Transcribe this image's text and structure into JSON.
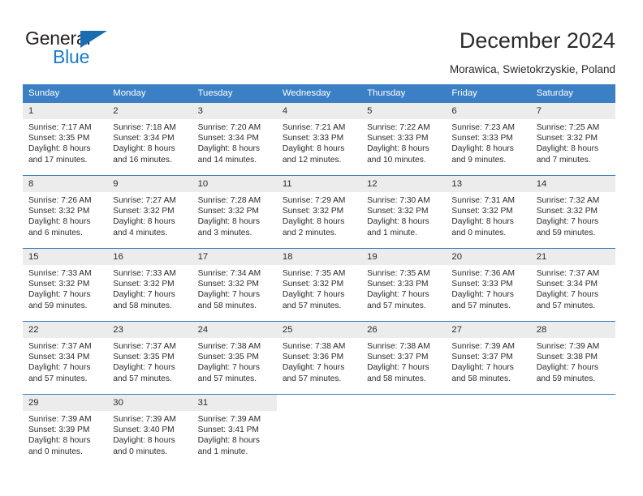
{
  "brand": {
    "name_dark": "General",
    "name_blue": "Blue",
    "triangle_icon": "triangle-icon",
    "accent_blue": "#1a7cc6",
    "logo_dark": "#231f20"
  },
  "header": {
    "title": "December 2024",
    "subtitle": "Morawica, Swietokrzyskie, Poland"
  },
  "theme": {
    "header_band": "#3b7fc4",
    "date_band": "#ececec",
    "text": "#2b2b2b",
    "page_bg": "#ffffff"
  },
  "calendar": {
    "day_headers": [
      "Sunday",
      "Monday",
      "Tuesday",
      "Wednesday",
      "Thursday",
      "Friday",
      "Saturday"
    ],
    "weeks": [
      {
        "dates": [
          "1",
          "2",
          "3",
          "4",
          "5",
          "6",
          "7"
        ],
        "cells": [
          {
            "sunrise": "Sunrise: 7:17 AM",
            "sunset": "Sunset: 3:35 PM",
            "daylight1": "Daylight: 8 hours",
            "daylight2": "and 17 minutes."
          },
          {
            "sunrise": "Sunrise: 7:18 AM",
            "sunset": "Sunset: 3:34 PM",
            "daylight1": "Daylight: 8 hours",
            "daylight2": "and 16 minutes."
          },
          {
            "sunrise": "Sunrise: 7:20 AM",
            "sunset": "Sunset: 3:34 PM",
            "daylight1": "Daylight: 8 hours",
            "daylight2": "and 14 minutes."
          },
          {
            "sunrise": "Sunrise: 7:21 AM",
            "sunset": "Sunset: 3:33 PM",
            "daylight1": "Daylight: 8 hours",
            "daylight2": "and 12 minutes."
          },
          {
            "sunrise": "Sunrise: 7:22 AM",
            "sunset": "Sunset: 3:33 PM",
            "daylight1": "Daylight: 8 hours",
            "daylight2": "and 10 minutes."
          },
          {
            "sunrise": "Sunrise: 7:23 AM",
            "sunset": "Sunset: 3:33 PM",
            "daylight1": "Daylight: 8 hours",
            "daylight2": "and 9 minutes."
          },
          {
            "sunrise": "Sunrise: 7:25 AM",
            "sunset": "Sunset: 3:32 PM",
            "daylight1": "Daylight: 8 hours",
            "daylight2": "and 7 minutes."
          }
        ]
      },
      {
        "dates": [
          "8",
          "9",
          "10",
          "11",
          "12",
          "13",
          "14"
        ],
        "cells": [
          {
            "sunrise": "Sunrise: 7:26 AM",
            "sunset": "Sunset: 3:32 PM",
            "daylight1": "Daylight: 8 hours",
            "daylight2": "and 6 minutes."
          },
          {
            "sunrise": "Sunrise: 7:27 AM",
            "sunset": "Sunset: 3:32 PM",
            "daylight1": "Daylight: 8 hours",
            "daylight2": "and 4 minutes."
          },
          {
            "sunrise": "Sunrise: 7:28 AM",
            "sunset": "Sunset: 3:32 PM",
            "daylight1": "Daylight: 8 hours",
            "daylight2": "and 3 minutes."
          },
          {
            "sunrise": "Sunrise: 7:29 AM",
            "sunset": "Sunset: 3:32 PM",
            "daylight1": "Daylight: 8 hours",
            "daylight2": "and 2 minutes."
          },
          {
            "sunrise": "Sunrise: 7:30 AM",
            "sunset": "Sunset: 3:32 PM",
            "daylight1": "Daylight: 8 hours",
            "daylight2": "and 1 minute."
          },
          {
            "sunrise": "Sunrise: 7:31 AM",
            "sunset": "Sunset: 3:32 PM",
            "daylight1": "Daylight: 8 hours",
            "daylight2": "and 0 minutes."
          },
          {
            "sunrise": "Sunrise: 7:32 AM",
            "sunset": "Sunset: 3:32 PM",
            "daylight1": "Daylight: 7 hours",
            "daylight2": "and 59 minutes."
          }
        ]
      },
      {
        "dates": [
          "15",
          "16",
          "17",
          "18",
          "19",
          "20",
          "21"
        ],
        "cells": [
          {
            "sunrise": "Sunrise: 7:33 AM",
            "sunset": "Sunset: 3:32 PM",
            "daylight1": "Daylight: 7 hours",
            "daylight2": "and 59 minutes."
          },
          {
            "sunrise": "Sunrise: 7:33 AM",
            "sunset": "Sunset: 3:32 PM",
            "daylight1": "Daylight: 7 hours",
            "daylight2": "and 58 minutes."
          },
          {
            "sunrise": "Sunrise: 7:34 AM",
            "sunset": "Sunset: 3:32 PM",
            "daylight1": "Daylight: 7 hours",
            "daylight2": "and 58 minutes."
          },
          {
            "sunrise": "Sunrise: 7:35 AM",
            "sunset": "Sunset: 3:32 PM",
            "daylight1": "Daylight: 7 hours",
            "daylight2": "and 57 minutes."
          },
          {
            "sunrise": "Sunrise: 7:35 AM",
            "sunset": "Sunset: 3:33 PM",
            "daylight1": "Daylight: 7 hours",
            "daylight2": "and 57 minutes."
          },
          {
            "sunrise": "Sunrise: 7:36 AM",
            "sunset": "Sunset: 3:33 PM",
            "daylight1": "Daylight: 7 hours",
            "daylight2": "and 57 minutes."
          },
          {
            "sunrise": "Sunrise: 7:37 AM",
            "sunset": "Sunset: 3:34 PM",
            "daylight1": "Daylight: 7 hours",
            "daylight2": "and 57 minutes."
          }
        ]
      },
      {
        "dates": [
          "22",
          "23",
          "24",
          "25",
          "26",
          "27",
          "28"
        ],
        "cells": [
          {
            "sunrise": "Sunrise: 7:37 AM",
            "sunset": "Sunset: 3:34 PM",
            "daylight1": "Daylight: 7 hours",
            "daylight2": "and 57 minutes."
          },
          {
            "sunrise": "Sunrise: 7:37 AM",
            "sunset": "Sunset: 3:35 PM",
            "daylight1": "Daylight: 7 hours",
            "daylight2": "and 57 minutes."
          },
          {
            "sunrise": "Sunrise: 7:38 AM",
            "sunset": "Sunset: 3:35 PM",
            "daylight1": "Daylight: 7 hours",
            "daylight2": "and 57 minutes."
          },
          {
            "sunrise": "Sunrise: 7:38 AM",
            "sunset": "Sunset: 3:36 PM",
            "daylight1": "Daylight: 7 hours",
            "daylight2": "and 57 minutes."
          },
          {
            "sunrise": "Sunrise: 7:38 AM",
            "sunset": "Sunset: 3:37 PM",
            "daylight1": "Daylight: 7 hours",
            "daylight2": "and 58 minutes."
          },
          {
            "sunrise": "Sunrise: 7:39 AM",
            "sunset": "Sunset: 3:37 PM",
            "daylight1": "Daylight: 7 hours",
            "daylight2": "and 58 minutes."
          },
          {
            "sunrise": "Sunrise: 7:39 AM",
            "sunset": "Sunset: 3:38 PM",
            "daylight1": "Daylight: 7 hours",
            "daylight2": "and 59 minutes."
          }
        ]
      },
      {
        "dates": [
          "29",
          "30",
          "31",
          "",
          "",
          "",
          ""
        ],
        "cells": [
          {
            "sunrise": "Sunrise: 7:39 AM",
            "sunset": "Sunset: 3:39 PM",
            "daylight1": "Daylight: 8 hours",
            "daylight2": "and 0 minutes."
          },
          {
            "sunrise": "Sunrise: 7:39 AM",
            "sunset": "Sunset: 3:40 PM",
            "daylight1": "Daylight: 8 hours",
            "daylight2": "and 0 minutes."
          },
          {
            "sunrise": "Sunrise: 7:39 AM",
            "sunset": "Sunset: 3:41 PM",
            "daylight1": "Daylight: 8 hours",
            "daylight2": "and 1 minute."
          },
          {
            "sunrise": "",
            "sunset": "",
            "daylight1": "",
            "daylight2": ""
          },
          {
            "sunrise": "",
            "sunset": "",
            "daylight1": "",
            "daylight2": ""
          },
          {
            "sunrise": "",
            "sunset": "",
            "daylight1": "",
            "daylight2": ""
          },
          {
            "sunrise": "",
            "sunset": "",
            "daylight1": "",
            "daylight2": ""
          }
        ]
      }
    ]
  }
}
